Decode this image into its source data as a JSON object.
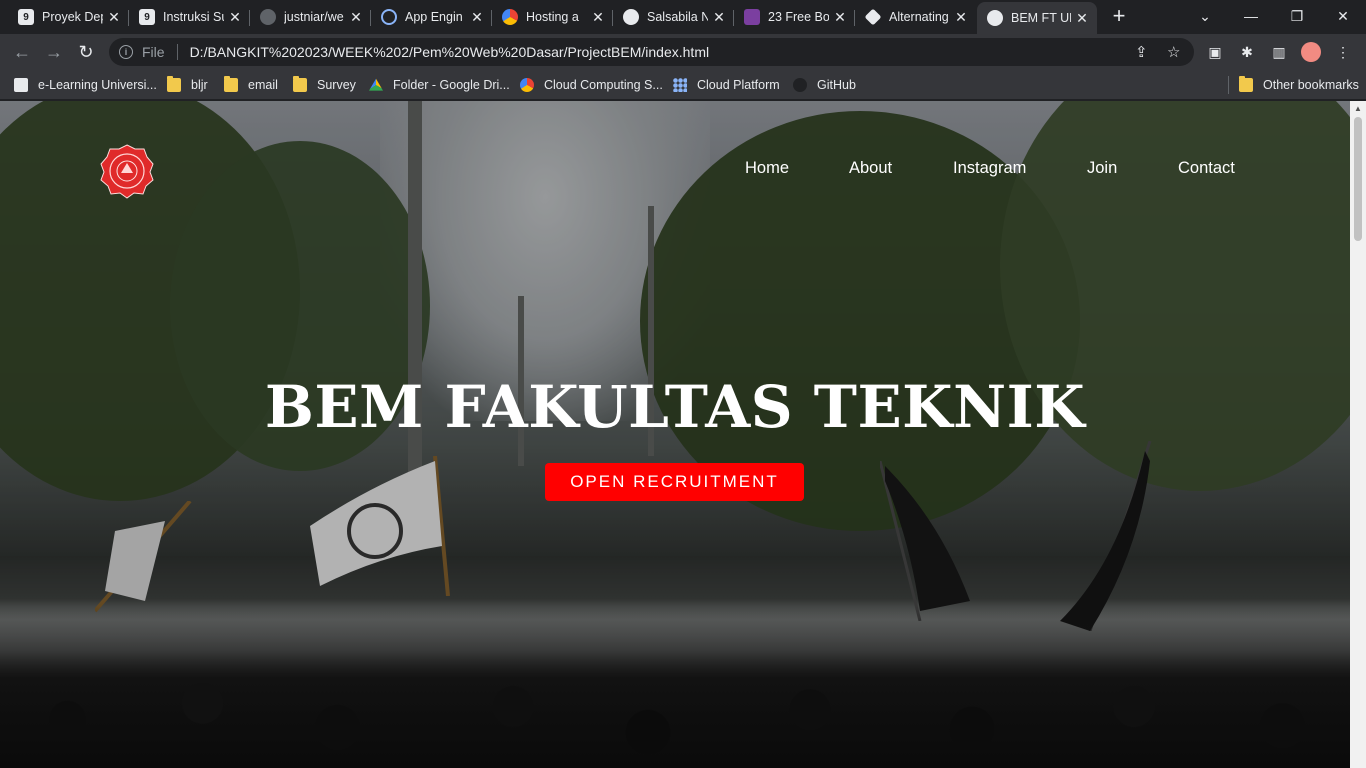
{
  "tabs": [
    {
      "title": "Proyek Dep",
      "favicon": "glitch-icon",
      "color": "#e8eaed"
    },
    {
      "title": "Instruksi Su",
      "favicon": "glitch-icon",
      "color": "#e8eaed"
    },
    {
      "title": "justniar/we",
      "favicon": "github-icon",
      "color": "#5f6368"
    },
    {
      "title": "App Engin",
      "favicon": "app-engine-icon",
      "color": "#8ab4f8"
    },
    {
      "title": "Hosting a",
      "favicon": "google-cloud-icon",
      "color": "#ea4335"
    },
    {
      "title": "Salsabila N",
      "favicon": "globe-icon",
      "color": "#e8eaed"
    },
    {
      "title": "23 Free Bo",
      "favicon": "colorlib-icon",
      "color": "#7b3fa0"
    },
    {
      "title": "Alternating",
      "favicon": "codepen-icon",
      "color": "#e8eaed"
    },
    {
      "title": "BEM FT UN",
      "favicon": "globe-icon",
      "color": "#e8eaed",
      "active": true
    }
  ],
  "toolbar": {
    "scheme": "File",
    "url": "D:/BANGKIT%202023/WEEK%202/Pem%20Web%20Dasar/ProjectBEM/index.html"
  },
  "bookmarks": [
    {
      "label": "e-Learning Universi...",
      "icon": "elearning-icon"
    },
    {
      "label": "bljr",
      "icon": "folder-icon"
    },
    {
      "label": "email",
      "icon": "folder-icon"
    },
    {
      "label": "Survey",
      "icon": "folder-icon"
    },
    {
      "label": "Folder - Google Dri...",
      "icon": "google-drive-icon"
    },
    {
      "label": "Cloud Computing S...",
      "icon": "google-cloud-icon"
    },
    {
      "label": "Cloud Platform",
      "icon": "cloud-platform-icon"
    },
    {
      "label": "GitHub",
      "icon": "github-icon"
    },
    {
      "label": "Other bookmarks",
      "icon": "folder-icon"
    }
  ],
  "page": {
    "nav": [
      "Home",
      "About",
      "Instagram",
      "Join",
      "Contact"
    ],
    "headline": "BEM FAKULTAS TEKNIK",
    "cta": "OPEN RECRUITMENT",
    "accent": "#ff0000"
  }
}
